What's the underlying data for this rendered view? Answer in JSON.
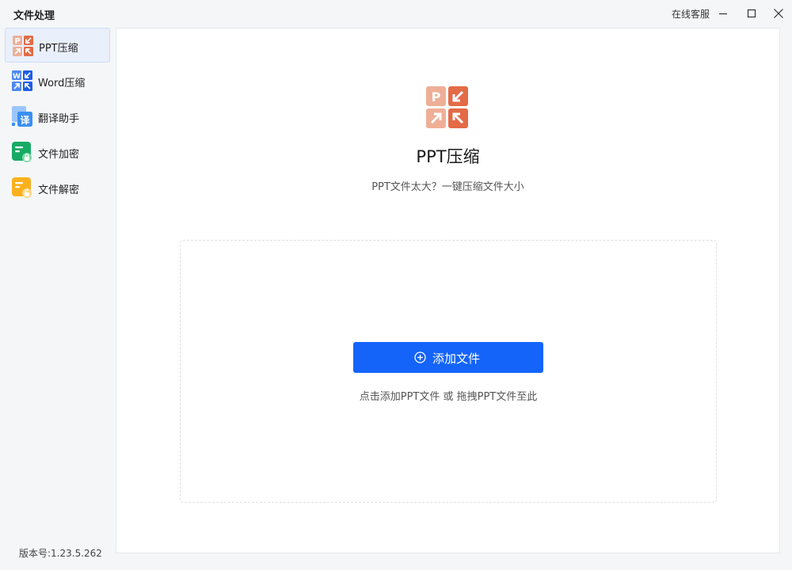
{
  "window": {
    "title": "文件处理",
    "support_link": "在线客服",
    "controls": {
      "minimize_icon": "minimize-icon",
      "maximize_icon": "maximize-icon",
      "close_icon": "close-icon"
    }
  },
  "sidebar": {
    "items": [
      {
        "label": "PPT压缩",
        "icon": "ppt-compress-icon",
        "active": true
      },
      {
        "label": "Word压缩",
        "icon": "word-compress-icon",
        "active": false
      },
      {
        "label": "翻译助手",
        "icon": "translate-icon",
        "active": false
      },
      {
        "label": "文件加密",
        "icon": "file-encrypt-icon",
        "active": false
      },
      {
        "label": "文件解密",
        "icon": "file-decrypt-icon",
        "active": false
      }
    ],
    "version": "版本号:1.23.5.262"
  },
  "main": {
    "title": "PPT压缩",
    "subtitle": "PPT文件太大？一键压缩文件大小",
    "add_button_label": "添加文件",
    "drop_hint": "点击添加PPT文件 或 拖拽PPT文件至此"
  },
  "colors": {
    "accent": "#1464fa",
    "ppt_light": "#efaf97",
    "ppt_dark": "#e36b46",
    "word": "#1e5de6",
    "translate": "#3b8ff2",
    "encrypt": "#16ab64",
    "decrypt": "#fbb11e",
    "active_bg": "#e9f0fc"
  }
}
